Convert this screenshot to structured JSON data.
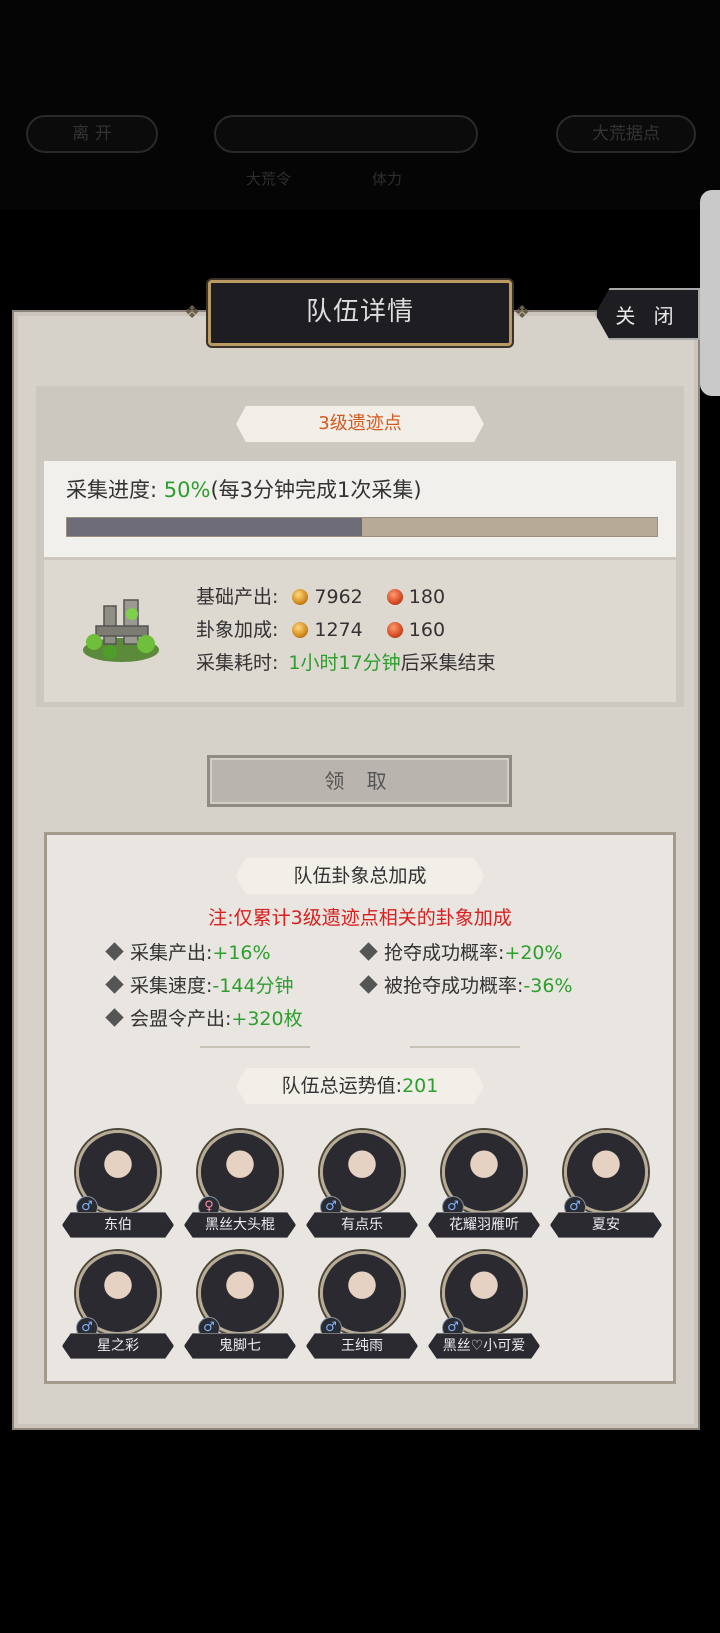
{
  "top": {
    "leave_label": "离 开",
    "center_label": "",
    "base_label": "大荒据点",
    "token_label": "大荒令",
    "stamina_label": "体力"
  },
  "panel": {
    "title": "队伍详情",
    "close_label": "关 闭"
  },
  "site": {
    "name": "3级遗迹点",
    "progress_label": "采集进度:",
    "progress_value": "50%",
    "progress_note": "(每3分钟完成1次采集)",
    "progress_fraction": 0.5,
    "base_label": "基础产出:",
    "base_gold": "7962",
    "base_red": "180",
    "bonus_label": "卦象加成:",
    "bonus_gold": "1274",
    "bonus_red": "160",
    "time_label": "采集耗时:",
    "time_value": "1小时17分钟",
    "time_suffix": "后采集结束",
    "icon": "ruins-icon"
  },
  "claim_label": "领 取",
  "team_bonus": {
    "title": "队伍卦象总加成",
    "note": "注:仅累计3级遗迹点相关的卦象加成",
    "items": [
      {
        "label": "采集产出:",
        "value": "+16%"
      },
      {
        "label": "抢夺成功概率:",
        "value": "+20%"
      },
      {
        "label": "采集速度:",
        "value": "-144分钟"
      },
      {
        "label": "被抢夺成功概率:",
        "value": "-36%"
      },
      {
        "label": "会盟令产出:",
        "value": "+320枚"
      }
    ]
  },
  "fortune": {
    "label": "队伍总运势值:",
    "value": "201"
  },
  "members": [
    {
      "name": "东伯",
      "gender": "♂"
    },
    {
      "name": "黑丝大头棍",
      "gender": "♀"
    },
    {
      "name": "有点乐",
      "gender": "♂"
    },
    {
      "name": "花耀羽雁听",
      "gender": "♂"
    },
    {
      "name": "夏安",
      "gender": "♂"
    },
    {
      "name": "星之彩",
      "gender": "♂"
    },
    {
      "name": "鬼脚七",
      "gender": "♂"
    },
    {
      "name": "王纯雨",
      "gender": "♂"
    },
    {
      "name": "黑丝♡小可爱",
      "gender": "♂"
    }
  ]
}
